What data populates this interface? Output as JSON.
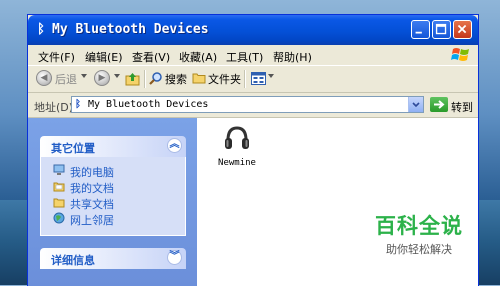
{
  "window": {
    "title": "My Bluetooth Devices"
  },
  "menu": [
    "文件(F)",
    "编辑(E)",
    "查看(V)",
    "收藏(A)",
    "工具(T)",
    "帮助(H)"
  ],
  "toolbar": {
    "back_label": "后退",
    "search_label": "搜索",
    "folders_label": "文件夹"
  },
  "address": {
    "label": "地址(D)",
    "value": "My Bluetooth Devices",
    "go_label": "转到"
  },
  "sidebar": {
    "other_places_title": "其它位置",
    "other_places": [
      {
        "label": "我的电脑",
        "icon": "computer-icon"
      },
      {
        "label": "我的文档",
        "icon": "documents-icon"
      },
      {
        "label": "共享文档",
        "icon": "shared-folder-icon"
      },
      {
        "label": "网上邻居",
        "icon": "network-icon"
      }
    ],
    "details_title": "详细信息"
  },
  "devices": [
    {
      "name": "Newmine",
      "icon": "headphones-icon"
    }
  ],
  "watermark": {
    "main": "百科全说",
    "sub": "助你轻松解决"
  },
  "colors": {
    "titlebar": "#0450d7",
    "link": "#215dc6",
    "watermark": "#2cb24a"
  }
}
